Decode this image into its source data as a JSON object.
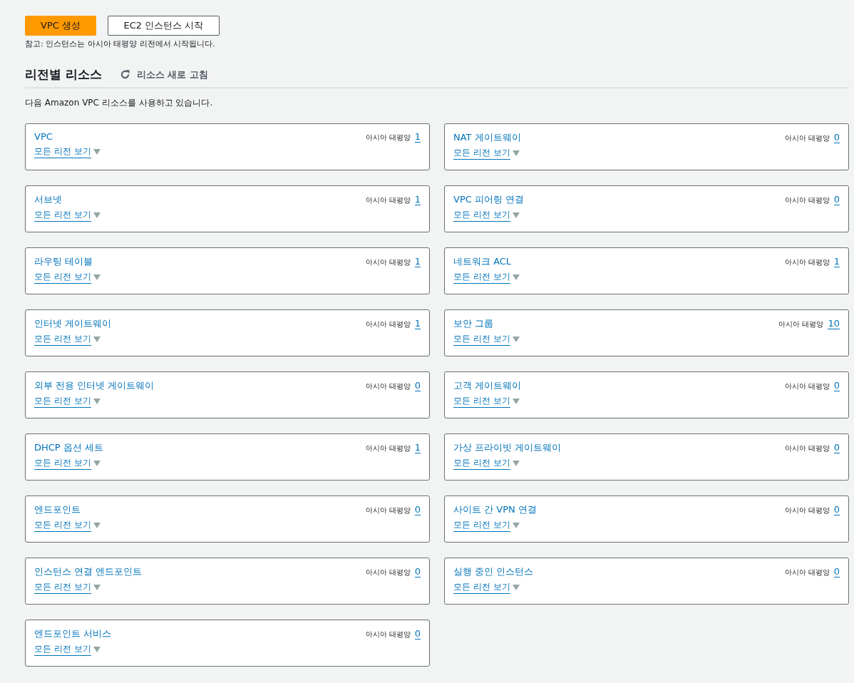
{
  "buttons": [
    {
      "label": "VPC 생성",
      "kind": "primary"
    },
    {
      "label": "EC2 인스턴스 시작",
      "kind": "normal"
    }
  ],
  "note": "참고: 인스턴스는 아시아 태평양 리전에서 시작됩니다.",
  "section": {
    "title": "리전별 리소스",
    "refresh": "리소스 새로 고침",
    "description": "다음 Amazon VPC 리소스를 사용하고 있습니다."
  },
  "resources": [
    {
      "name": "VPC",
      "region": "아시아 태평양",
      "count": "1",
      "link": "모든 리전 보기"
    },
    {
      "name": "NAT 게이트웨이",
      "region": "아시아 태평양",
      "count": "0",
      "link": "모든 리전 보기"
    },
    {
      "name": "서브넷",
      "region": "아시아 태평양",
      "count": "1",
      "link": "모든 리전 보기"
    },
    {
      "name": "VPC 피어링 연결",
      "region": "아시아 태평양",
      "count": "0",
      "link": "모든 리전 보기"
    },
    {
      "name": "라우팅 테이블",
      "region": "아시아 태평양",
      "count": "1",
      "link": "모든 리전 보기"
    },
    {
      "name": "네트워크 ACL",
      "region": "아시아 태평양",
      "count": "1",
      "link": "모든 리전 보기"
    },
    {
      "name": "인터넷 게이트웨이",
      "region": "아시아 태평양",
      "count": "1",
      "link": "모든 리전 보기"
    },
    {
      "name": "보안 그룹",
      "region": "아시아 태평양",
      "count": "10",
      "link": "모든 리전 보기"
    },
    {
      "name": "외부 전용 인터넷 게이트웨이",
      "region": "아시아 태평양",
      "count": "0",
      "link": "모든 리전 보기"
    },
    {
      "name": "고객 게이트웨이",
      "region": "아시아 태평양",
      "count": "0",
      "link": "모든 리전 보기"
    },
    {
      "name": "DHCP 옵션 세트",
      "region": "아시아 태평양",
      "count": "1",
      "link": "모든 리전 보기"
    },
    {
      "name": "가상 프라이빗 게이트웨이",
      "region": "아시아 태평양",
      "count": "0",
      "link": "모든 리전 보기"
    },
    {
      "name": "엔드포인트",
      "region": "아시아 태평양",
      "count": "0",
      "link": "모든 리전 보기"
    },
    {
      "name": "사이트 간 VPN 연결",
      "region": "아시아 태평양",
      "count": "0",
      "link": "모든 리전 보기"
    },
    {
      "name": "인스턴스 연결 엔드포인트",
      "region": "아시아 태평양",
      "count": "0",
      "link": "모든 리전 보기"
    },
    {
      "name": "실행 중인 인스턴스",
      "region": "아시아 태평양",
      "count": "0",
      "link": "모든 리전 보기"
    },
    {
      "name": "엔드포인트 서비스",
      "region": "아시아 태평양",
      "count": "0",
      "link": "모든 리전 보기"
    }
  ]
}
